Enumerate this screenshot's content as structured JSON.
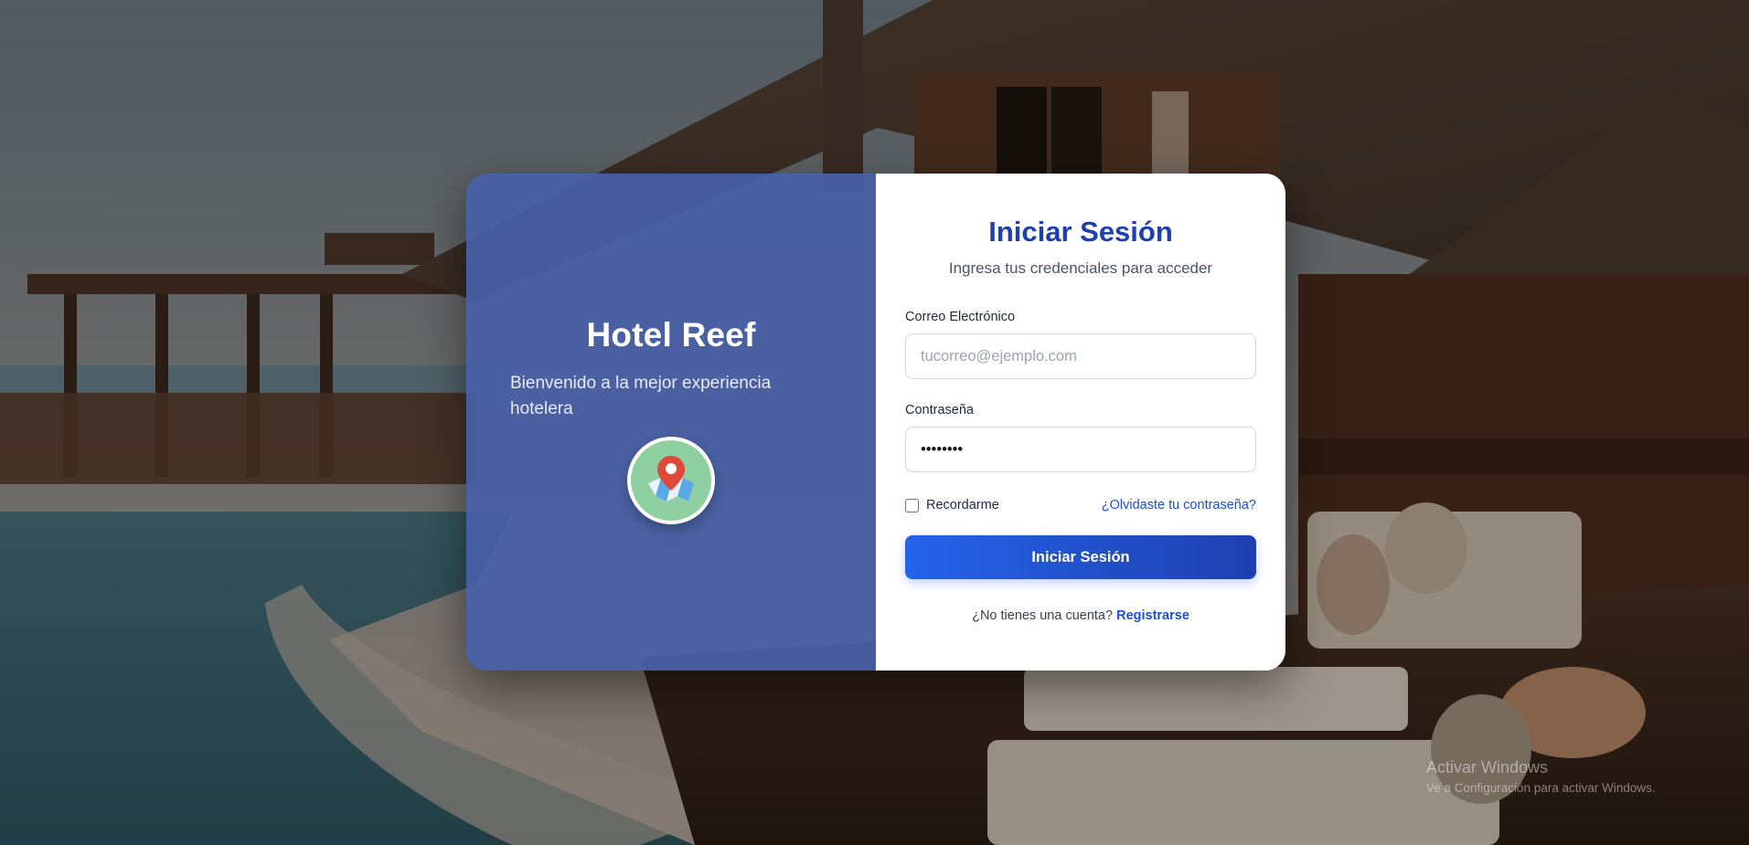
{
  "background": {
    "description_icon": "resort-pool-photo"
  },
  "brand": {
    "title": "Hotel Reef",
    "subtitle": "Bienvenido a la mejor experiencia hotelera",
    "icon": "map-pin-icon"
  },
  "form": {
    "title": "Iniciar Sesión",
    "subtitle": "Ingresa tus credenciales para acceder",
    "email_label": "Correo Electrónico",
    "email_placeholder": "tucorreo@ejemplo.com",
    "email_value": "",
    "password_label": "Contraseña",
    "password_value": "••••••••",
    "remember_label": "Recordarme",
    "remember_checked": false,
    "forgot_link": "¿Olvidaste tu contraseña?",
    "submit_label": "Iniciar Sesión",
    "register_prompt": "¿No tienes una cuenta?",
    "register_link": "Registrarse"
  },
  "watermark": {
    "title": "Activar Windows",
    "subtitle": "Ve a Configuración para activar Windows."
  },
  "colors": {
    "accent": "#1e40af",
    "left_panel": "#4860a8",
    "button_start": "#2563eb",
    "button_end": "#1e40af",
    "badge": "#8fd0a2",
    "pin": "#e0483a"
  }
}
